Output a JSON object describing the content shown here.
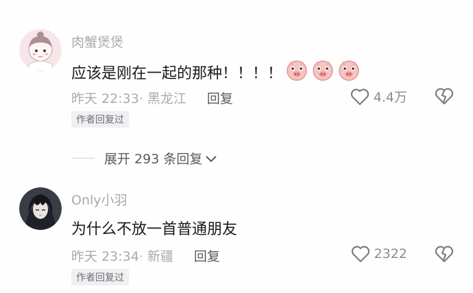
{
  "comments": [
    {
      "username": "肉蟹煲煲",
      "text": "应该是刚在一起的那种！！！！",
      "emoji_icon": "pig-face-icon",
      "emoji_count": 3,
      "time": "昨天 22:33",
      "location": "· 黑龙江",
      "reply_label": "回复",
      "likes": "4.4万",
      "badge": "作者回复过",
      "avatar": "anime-girl-avatar"
    },
    {
      "username": "Only小羽",
      "text": "为什么不放一首普通朋友",
      "time": "昨天 23:34",
      "location": "· 新疆",
      "reply_label": "回复",
      "likes": "2322",
      "badge": "作者回复过",
      "avatar": "dark-hair-anime-avatar"
    }
  ],
  "expand": {
    "label": "展开 293 条回复"
  },
  "colors": {
    "meta": "#a9aaae",
    "text": "#1a1a1a",
    "badge_bg": "#f0f0f2"
  }
}
